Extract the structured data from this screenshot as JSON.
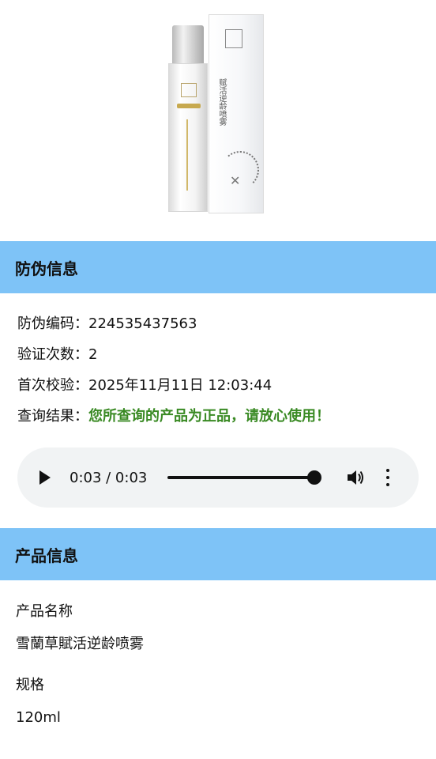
{
  "product_image": {
    "box_text": "赋活逆龄喷雾"
  },
  "security_section": {
    "title": "防伪信息",
    "rows": [
      {
        "label": "防伪编码：",
        "value": "224535437563"
      },
      {
        "label": "验证次数：",
        "value": "2"
      },
      {
        "label": "首次校验：",
        "value": "2025年11月11日 12:03:44"
      },
      {
        "label": "查询结果：",
        "value": "您所查询的产品为正品，请放心使用！"
      }
    ],
    "result_color": "#3a8a24"
  },
  "audio_player": {
    "time": "0:03 / 0:03",
    "progress_fraction": 1.0
  },
  "product_section": {
    "title": "产品信息",
    "fields": [
      {
        "label": "产品名称",
        "value": "雪蘭草賦活逆龄喷雾"
      },
      {
        "label": "规格",
        "value": "120ml"
      }
    ]
  },
  "colors": {
    "header_bg": "#7ec3f7",
    "player_bg": "#f1f3f4"
  }
}
